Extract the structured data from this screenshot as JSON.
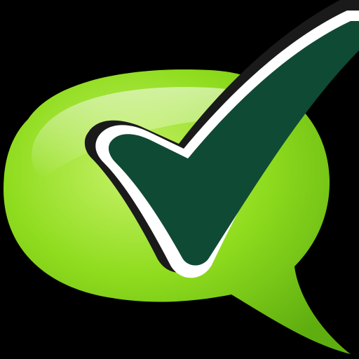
{
  "icon": {
    "name": "chat-bubble-checkmark-icon",
    "bubble_icon": "speech-bubble-icon",
    "check_icon": "checkmark-icon"
  },
  "colors": {
    "background": "#000000",
    "bubble_light": "#c8f26a",
    "bubble_mid": "#8fdc1e",
    "bubble_dark": "#5fae10",
    "check_fill": "#0f4a35",
    "check_outline": "#ffffff",
    "check_shadow": "#1a1a1a"
  }
}
